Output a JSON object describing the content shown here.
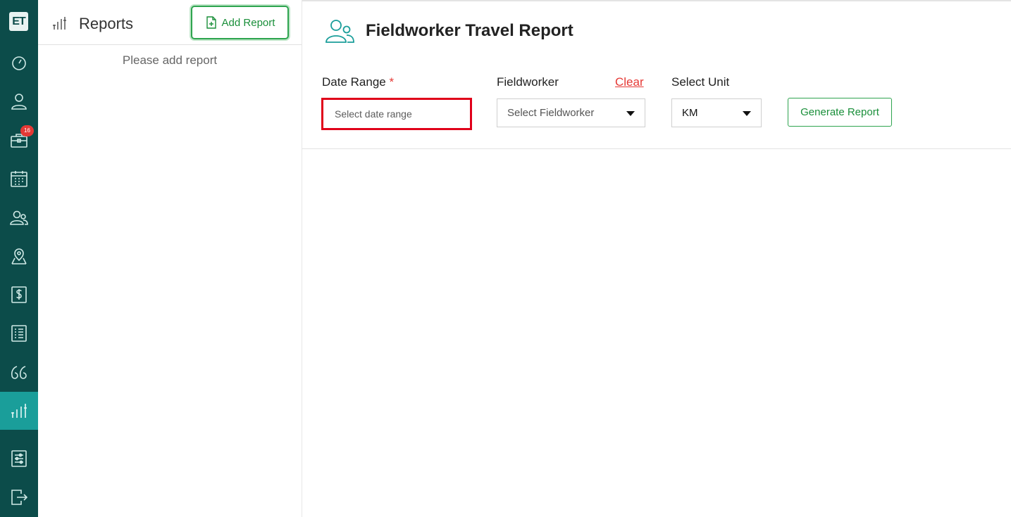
{
  "rail": {
    "logo": "ET",
    "badge_count": "16",
    "items": [
      {
        "icon": "dashboard-gauge-icon"
      },
      {
        "icon": "user-icon"
      },
      {
        "icon": "briefcase-icon"
      },
      {
        "icon": "calendar-icon"
      },
      {
        "icon": "users-icon"
      },
      {
        "icon": "map-pin-icon"
      },
      {
        "icon": "dollar-icon"
      },
      {
        "icon": "list-document-icon"
      },
      {
        "icon": "quote-icon"
      },
      {
        "icon": "reports-bars-icon",
        "active": true
      },
      {
        "icon": "settings-sliders-icon"
      },
      {
        "icon": "logout-icon"
      }
    ],
    "colors": {
      "background": "#0c4c4a",
      "active": "#1a9e9a",
      "badge": "#e53935"
    }
  },
  "panel": {
    "title": "Reports",
    "add_button": "Add Report",
    "empty_text": "Please add report"
  },
  "main": {
    "title": "Fieldworker Travel Report",
    "filters": {
      "date_range_label": "Date Range",
      "required_mark": "*",
      "date_range_placeholder": "Select date range",
      "fieldworker_label": "Fieldworker",
      "clear_label": "Clear",
      "fieldworker_placeholder": "Select Fieldworker",
      "unit_label": "Select Unit",
      "unit_value": "KM",
      "generate_button": "Generate Report"
    },
    "colors": {
      "accent": "#2ea44f",
      "error": "#e0001a"
    }
  }
}
